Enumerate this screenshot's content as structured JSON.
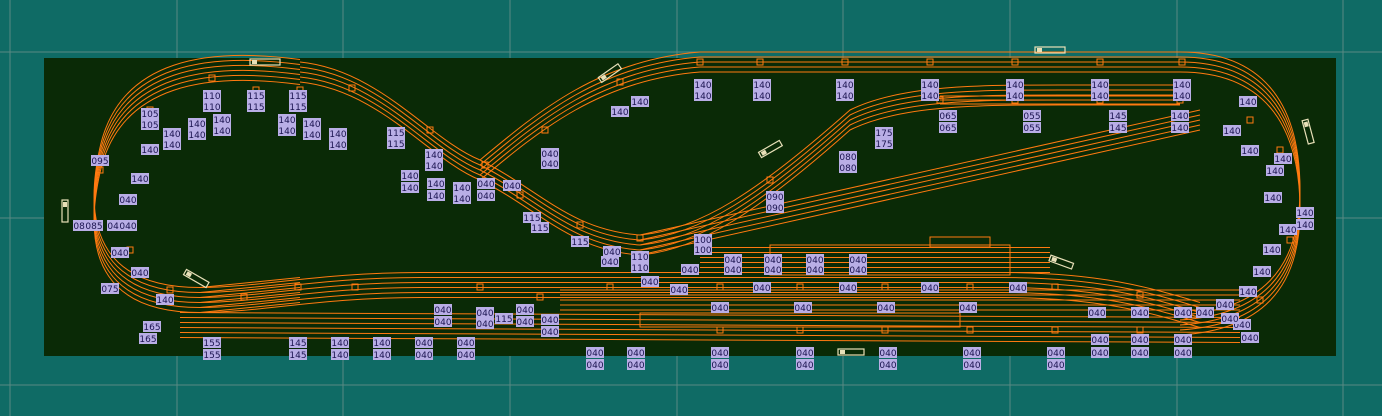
{
  "colors": {
    "background": "#0f6b65",
    "board": "#0a2a06",
    "grid": "#5a8a82",
    "track": "#ff7a10",
    "label_fill": "#b9aee6",
    "label_text": "#1b1450",
    "train": "#e8e0b8"
  },
  "elevation_labels": [
    "110",
    "110",
    "115",
    "115",
    "115",
    "115",
    "105",
    "105",
    "140",
    "140",
    "140",
    "140",
    "140",
    "140",
    "140",
    "140",
    "140",
    "140",
    "140",
    "140",
    "095",
    "140",
    "140",
    "085",
    "085",
    "040",
    "040",
    "040",
    "040",
    "040",
    "075",
    "140",
    "165",
    "165",
    "155",
    "155",
    "145",
    "145",
    "140",
    "140",
    "140",
    "140",
    "040",
    "040",
    "040",
    "040",
    "040",
    "040",
    "040",
    "040",
    "115",
    "115",
    "140",
    "140",
    "140",
    "140",
    "140",
    "140",
    "140",
    "140",
    "040",
    "040",
    "040",
    "115",
    "115",
    "115",
    "115",
    "040",
    "040",
    "040",
    "040",
    "110",
    "110",
    "100",
    "100",
    "040",
    "040",
    "040",
    "040",
    "040",
    "040",
    "040",
    "040",
    "040",
    "040",
    "040",
    "040",
    "040",
    "040",
    "040",
    "040",
    "040",
    "040",
    "040",
    "040",
    "040",
    "040",
    "040",
    "080",
    "080",
    "090",
    "090",
    "175",
    "175",
    "065",
    "065",
    "055",
    "055",
    "145",
    "145",
    "140",
    "140",
    "140",
    "140",
    "140",
    "140",
    "140",
    "140",
    "140",
    "140",
    "140",
    "140",
    "140",
    "140",
    "140",
    "140",
    "140",
    "140",
    "140",
    "140",
    "140",
    "140",
    "140",
    "140",
    "140",
    "140",
    "140",
    "140",
    "140",
    "140",
    "040",
    "040",
    "040",
    "040",
    "040",
    "040",
    "040",
    "040",
    "040",
    "040",
    "040",
    "040",
    "040",
    "040",
    "040",
    "040",
    "040",
    "040",
    "040",
    "040",
    "040",
    "040",
    "040",
    "040",
    "040",
    "040",
    "040",
    "040"
  ]
}
